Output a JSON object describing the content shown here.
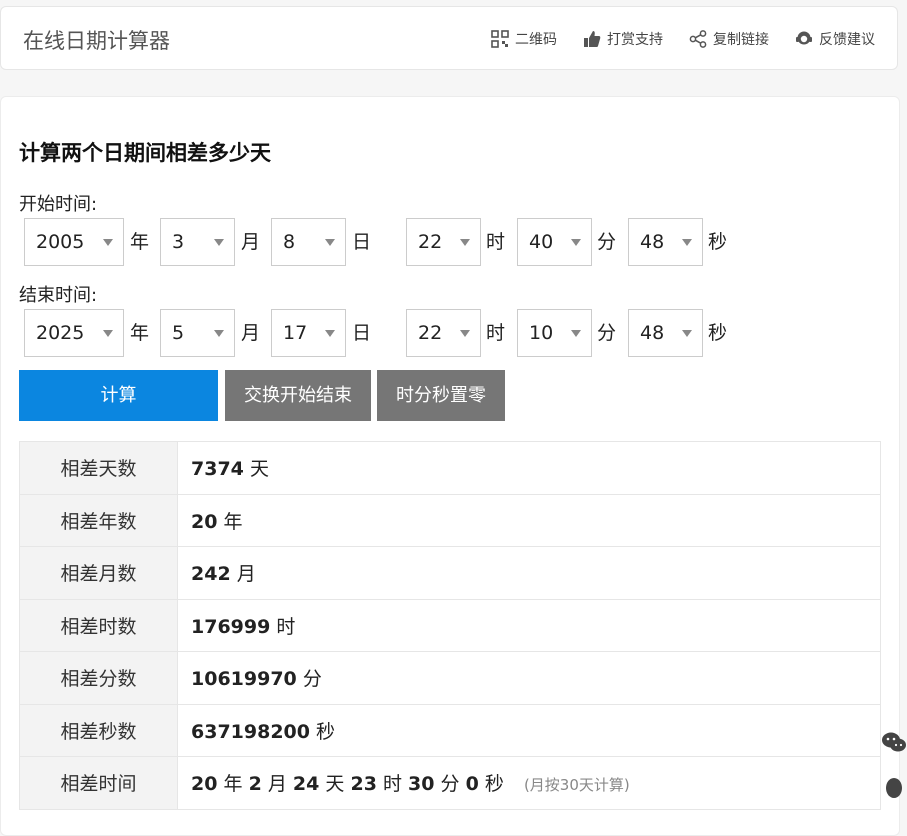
{
  "app": {
    "title": "在线日期计算器"
  },
  "toolbar": [
    {
      "label": "二维码",
      "icon": "qrcode-icon"
    },
    {
      "label": "打赏支持",
      "icon": "thumbs-up-icon"
    },
    {
      "label": "复制链接",
      "icon": "share-icon"
    },
    {
      "label": "反馈建议",
      "icon": "feedback-icon"
    }
  ],
  "main": {
    "title": "计算两个日期间相差多少天",
    "start": {
      "label": "开始时间:",
      "year": "2005",
      "month": "3",
      "day": "8",
      "hour": "22",
      "minute": "40",
      "second": "48"
    },
    "end": {
      "label": "结束时间:",
      "year": "2025",
      "month": "5",
      "day": "17",
      "hour": "22",
      "minute": "10",
      "second": "48"
    },
    "units": {
      "year": "年",
      "month": "月",
      "day": "日",
      "hour": "时",
      "minute": "分",
      "second": "秒"
    },
    "buttons": {
      "calculate": "计算",
      "swap": "交换开始结束",
      "reset_time": "时分秒置零"
    },
    "results": [
      {
        "label": "相差天数",
        "value": "7374",
        "unit": "天"
      },
      {
        "label": "相差年数",
        "value": "20",
        "unit": "年"
      },
      {
        "label": "相差月数",
        "value": "242",
        "unit": "月"
      },
      {
        "label": "相差时数",
        "value": "176999",
        "unit": "时"
      },
      {
        "label": "相差分数",
        "value": "10619970",
        "unit": "分"
      },
      {
        "label": "相差秒数",
        "value": "637198200",
        "unit": "秒"
      }
    ],
    "diff_time": {
      "label": "相差时间",
      "years": "20",
      "y_unit": "年",
      "months": "2",
      "m_unit": "月",
      "days": "24",
      "d_unit": "天",
      "hours": "23",
      "h_unit": "时",
      "minutes": "30",
      "min_unit": "分",
      "seconds": "0",
      "s_unit": "秒",
      "note": "(月按30天计算)"
    }
  },
  "colors": {
    "primary": "#0b86e0",
    "secondary": "#767676"
  }
}
